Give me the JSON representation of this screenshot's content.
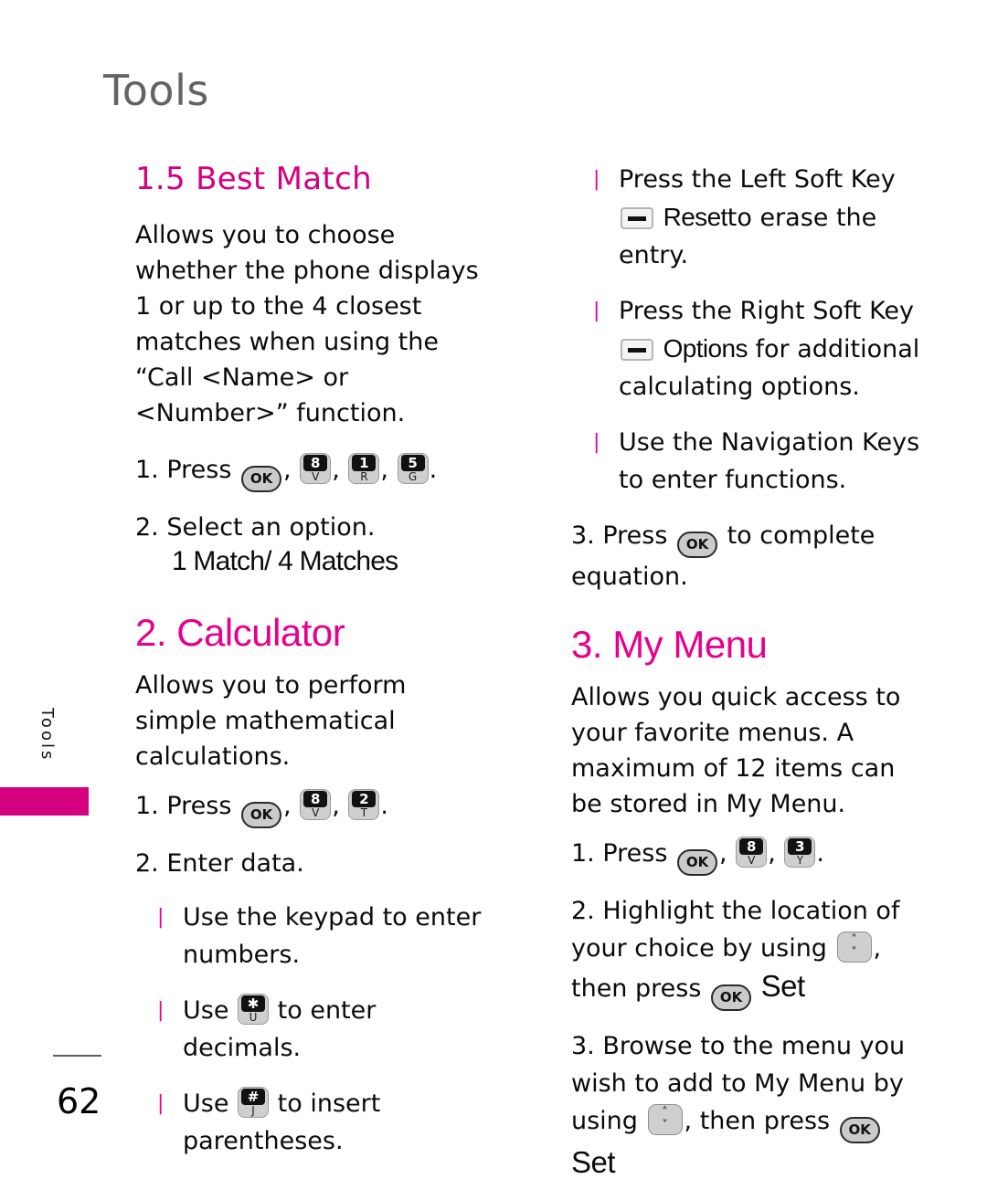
{
  "page": {
    "chapter_title": "Tools",
    "side_tab_label": "Tools",
    "page_number": "62",
    "accent_color": "#d4007f",
    "heading_color": "#e6008c",
    "chapter_color": "#636363"
  },
  "left_column": {
    "section_1": {
      "heading": "1.5 Best Match",
      "description": "Allows you to choose whether the phone displays 1 or up to the 4 closest matches when using the “Call <Name> or <Number>” function.",
      "step1_label": "1. Press",
      "step1_keys": [
        {
          "icon": "ok-key",
          "glyph": "OK"
        },
        {
          "icon": "number-key",
          "glyph": "8",
          "letter": "V"
        },
        {
          "icon": "number-key",
          "glyph": "1",
          "letter": "R"
        },
        {
          "icon": "number-key",
          "glyph": "5",
          "letter": "G"
        }
      ],
      "step2_label": "2. Select an option.",
      "step2_options": "1 Match/ 4 Matches"
    },
    "section_2": {
      "heading": "2. Calculator",
      "description": "Allows you to perform simple mathematical calculations.",
      "step1_label": "1. Press",
      "step1_keys": [
        {
          "icon": "ok-key",
          "glyph": "OK"
        },
        {
          "icon": "number-key",
          "glyph": "8",
          "letter": "V"
        },
        {
          "icon": "number-key",
          "glyph": "2",
          "letter": "T"
        }
      ],
      "step2_label": "2. Enter data.",
      "bullets": [
        {
          "text_before": "Use the keypad to enter numbers.",
          "key": null,
          "text_after": ""
        },
        {
          "text_before": "Use",
          "key": {
            "icon": "star-key",
            "glyph": "✱",
            "letter": "U"
          },
          "text_after": "to enter decimals."
        },
        {
          "text_before": "Use",
          "key": {
            "icon": "pound-key",
            "glyph": "#",
            "letter": "J"
          },
          "text_after": "to insert parentheses."
        }
      ]
    }
  },
  "right_column": {
    "calculator_bullets": [
      {
        "text_before": "Press the Left Soft Key",
        "key": {
          "icon": "soft-key"
        },
        "emphasis": "Reset",
        "text_after": "to erase the entry."
      },
      {
        "text_before": "Press the Right Soft Key",
        "key": {
          "icon": "soft-key"
        },
        "emphasis": "Options",
        "text_after": "for additional calculating options."
      },
      {
        "text_before": "Use the Navigation Keys to enter functions.",
        "key": null,
        "emphasis": "",
        "text_after": ""
      }
    ],
    "calculator_step3": {
      "label_before": "3. Press",
      "key": {
        "icon": "ok-key",
        "glyph": "OK"
      },
      "label_after": "to complete equation."
    },
    "section_3": {
      "heading": "3. My Menu",
      "description": "Allows you quick access to your favorite menus. A maximum of 12 items can be stored in My Menu.",
      "step1_label": "1. Press",
      "step1_keys": [
        {
          "icon": "ok-key",
          "glyph": "OK"
        },
        {
          "icon": "number-key",
          "glyph": "8",
          "letter": "V"
        },
        {
          "icon": "number-key",
          "glyph": "3",
          "letter": "Y"
        }
      ],
      "step2_part1": "2. Highlight the location of your choice by using",
      "step2_nav_key": {
        "icon": "nav-key",
        "up": "˄",
        "down": "˅"
      },
      "step2_part2": ", then press",
      "step2_ok_key": {
        "icon": "ok-key",
        "glyph": "OK"
      },
      "step2_emphasis": "Set",
      "step3_part1": "3. Browse to the menu you wish to add to My Menu by using",
      "step3_nav_key": {
        "icon": "nav-key",
        "up": "˄",
        "down": "˅"
      },
      "step3_part2": ", then press",
      "step3_ok_key": {
        "icon": "ok-key",
        "glyph": "OK"
      },
      "step3_emphasis": "Set"
    }
  }
}
